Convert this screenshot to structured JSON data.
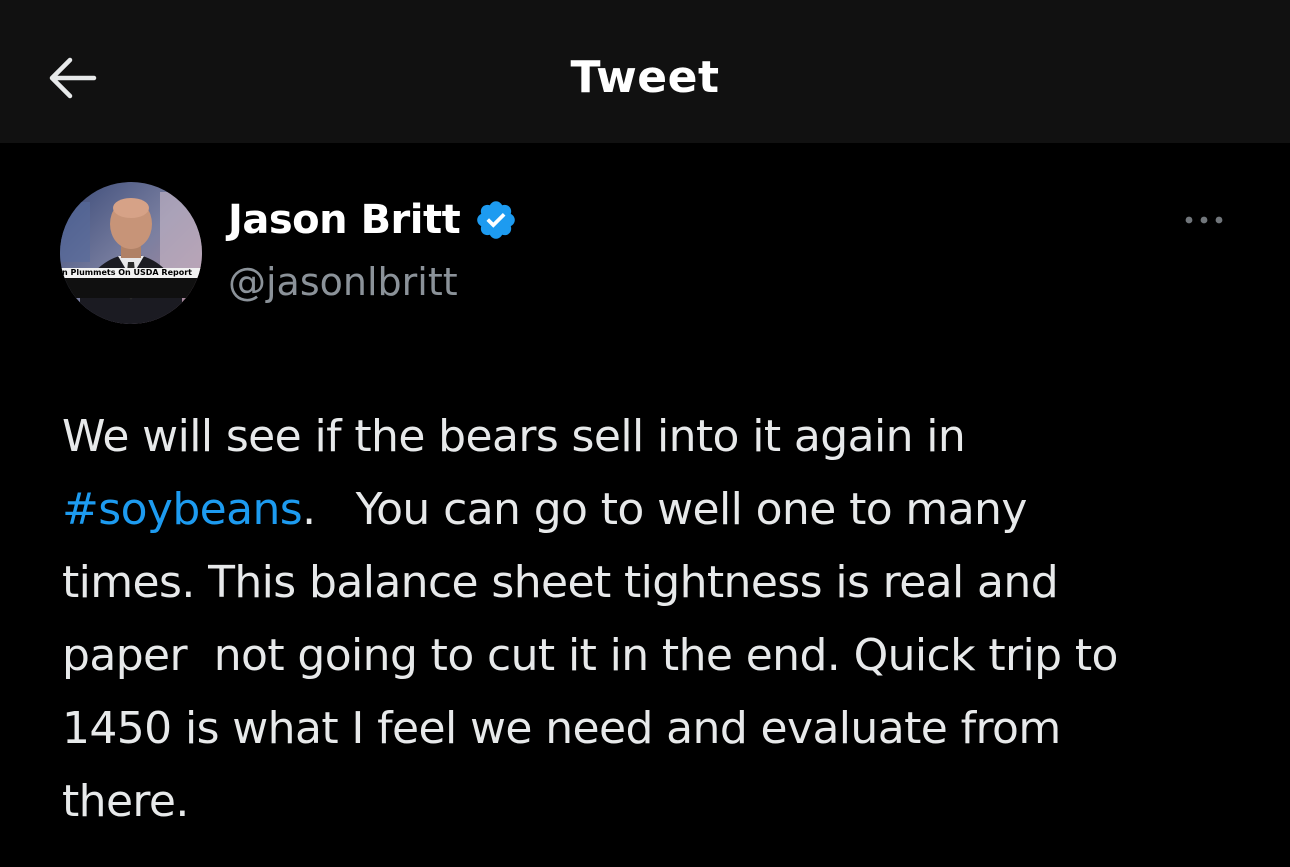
{
  "header": {
    "title": "Tweet",
    "back_icon": "arrow-left-icon"
  },
  "author": {
    "name": "Jason Britt",
    "handle": "@jasonlbritt",
    "verified_icon": "verified-badge-icon",
    "avatar_caption": "n Plummets On USDA Report"
  },
  "menu": {
    "icon": "more-horizontal-icon"
  },
  "tweet": {
    "lines": [
      "We will see if the bears sell into it again in",
      "",
      "times. This balance sheet tightness is real and",
      "paper  not going to cut it in the end. Quick trip to",
      "1450 is what I feel we need and evaluate from",
      "there."
    ],
    "hashtag": "#soybeans",
    "after_hashtag": ".   You can go to well one to many"
  },
  "colors": {
    "background": "#000000",
    "header_background": "#111111",
    "text": "#e7e9ea",
    "secondary_text": "#8b9299",
    "accent": "#1d9bf0"
  }
}
